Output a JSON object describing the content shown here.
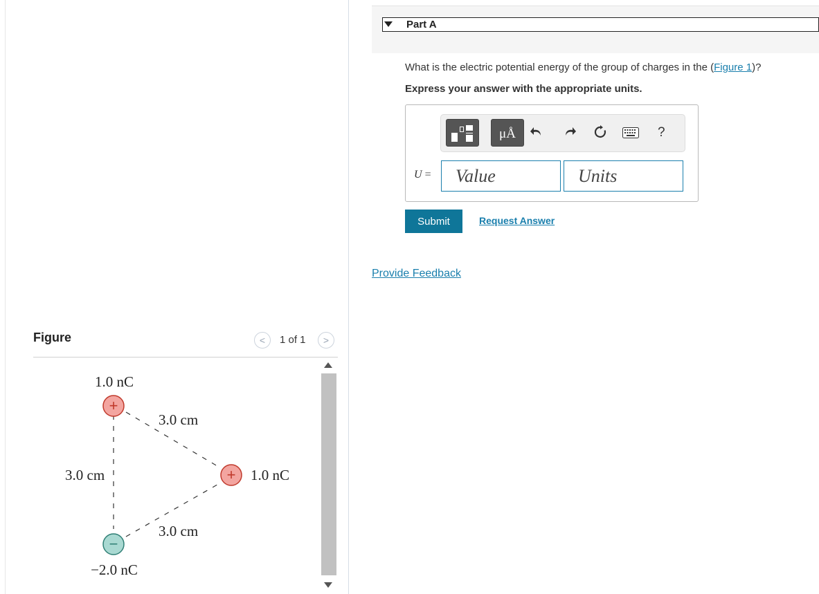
{
  "part": {
    "label": "Part A"
  },
  "question": {
    "prefix": "What is the electric potential energy of the group of charges in the (",
    "link": "Figure 1",
    "suffix": ")?"
  },
  "instruction": "Express your answer with the appropriate units.",
  "toolbar": {
    "units_symbol": "μÅ",
    "undo_icon": "undo-icon",
    "redo_icon": "redo-icon",
    "reset_icon": "reset-icon",
    "keyboard_icon": "keyboard-icon",
    "help_label": "?"
  },
  "answer": {
    "variable": "U",
    "equals": " =",
    "value_placeholder": "Value",
    "units_placeholder": "Units"
  },
  "buttons": {
    "submit": "Submit",
    "request_answer": "Request Answer",
    "provide_feedback": "Provide Feedback"
  },
  "figure": {
    "title": "Figure",
    "pager": "1 of 1",
    "charges": [
      {
        "label": "1.0 nC",
        "sign": "+"
      },
      {
        "label": "1.0 nC",
        "sign": "+"
      },
      {
        "label": "−2.0 nC",
        "sign": "−"
      }
    ],
    "distances": [
      "3.0 cm",
      "3.0 cm",
      "3.0 cm"
    ]
  },
  "colors": {
    "accent": "#0f7699",
    "link": "#1a7fad",
    "positive_fill": "#f3a5a0",
    "positive_stroke": "#c0392b",
    "negative_fill": "#a9d9d2",
    "negative_stroke": "#2f7f75"
  }
}
